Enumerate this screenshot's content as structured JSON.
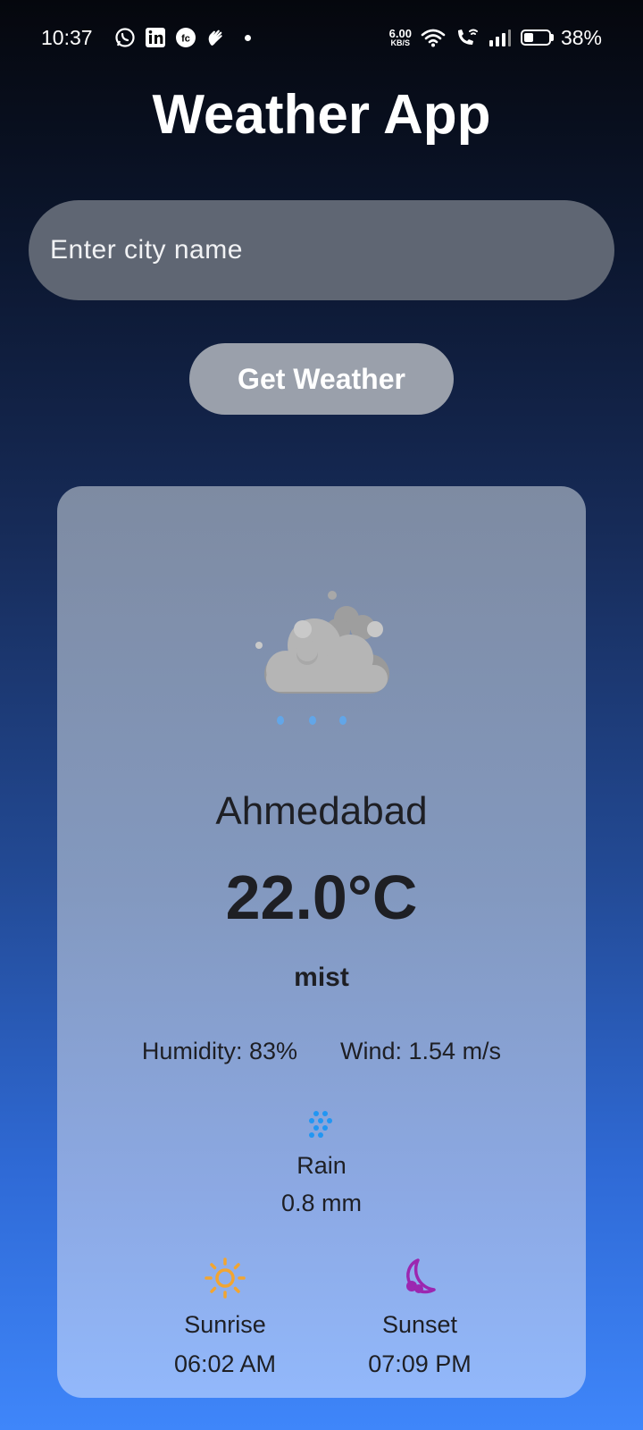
{
  "status_bar": {
    "time": "10:37",
    "net_speed_value": "6.00",
    "net_speed_unit": "KB/S",
    "battery_percent": "38%",
    "battery_level": 0.38,
    "notification_icons": [
      "whatsapp-icon",
      "linkedin-icon",
      "fc-icon",
      "hand-wave-icon"
    ],
    "system_icons": [
      "wifi-icon",
      "wifi-calling-icon",
      "signal-icon",
      "battery-icon"
    ]
  },
  "header": {
    "title": "Weather App"
  },
  "search": {
    "placeholder": "Enter city name",
    "value": "",
    "button_label": "Get Weather"
  },
  "weather": {
    "icon": "mist-cloud-icon",
    "city": "Ahmedabad",
    "temperature": "22.0°C",
    "description": "mist",
    "humidity": "Humidity: 83%",
    "wind": "Wind: 1.54 m/s",
    "rain": {
      "icon": "rain-drops-icon",
      "label": "Rain",
      "value": "0.8 mm"
    },
    "sunrise": {
      "icon": "sun-icon",
      "label": "Sunrise",
      "time": "06:02 AM"
    },
    "sunset": {
      "icon": "moon-icon",
      "label": "Sunset",
      "time": "07:09 PM"
    }
  },
  "colors": {
    "card_top": "#7e8ba2",
    "card_bottom": "#92b8fb",
    "sun": "#f2a531",
    "moon": "#9c27b0",
    "rain": "#2196f3"
  }
}
